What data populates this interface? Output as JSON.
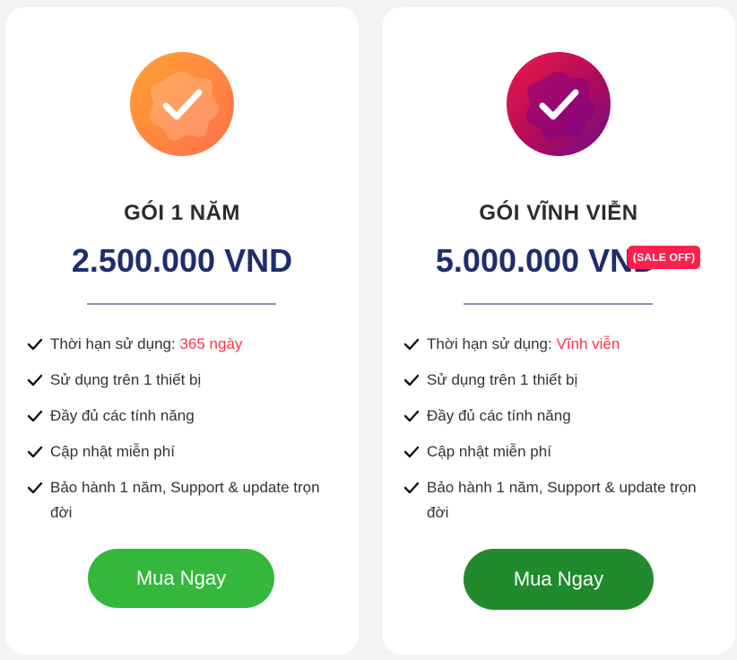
{
  "colors": {
    "card_background": "#ffffff",
    "page_background": "#f3f3f6",
    "price": "#1f2d6e",
    "highlight": "#ff3348",
    "sale_badge": "#ff1f4b",
    "buy_button_1": "#33b83c",
    "buy_button_2": "#218a2c"
  },
  "plans": [
    {
      "icon": "check-badge-icon",
      "title": "GÓI 1 NĂM",
      "price": "2.500.000 VND",
      "features": [
        {
          "label": "Thời hạn sử dụng:",
          "highlight": "365 ngày"
        },
        {
          "label": "Sử dụng trên 1 thiết bị"
        },
        {
          "label": "Đầy đủ các tính năng"
        },
        {
          "label": "Cập nhật miễn phí"
        },
        {
          "label": "Bảo hành 1 năm, Support & update trọn đời"
        }
      ],
      "button": "Mua Ngay"
    },
    {
      "icon": "check-badge-icon",
      "title": "GÓI VĨNH VIỄN",
      "price": "5.000.000 VND",
      "sale_badge": "(SALE OFF)",
      "features": [
        {
          "label": "Thời hạn sử dụng:",
          "highlight": "Vĩnh viễn"
        },
        {
          "label": "Sử dụng trên 1 thiết bị"
        },
        {
          "label": "Đầy đủ các tính năng"
        },
        {
          "label": "Cập nhật miễn phí"
        },
        {
          "label": "Bảo hành 1 năm, Support & update trọn đời"
        }
      ],
      "button": "Mua Ngay"
    }
  ]
}
